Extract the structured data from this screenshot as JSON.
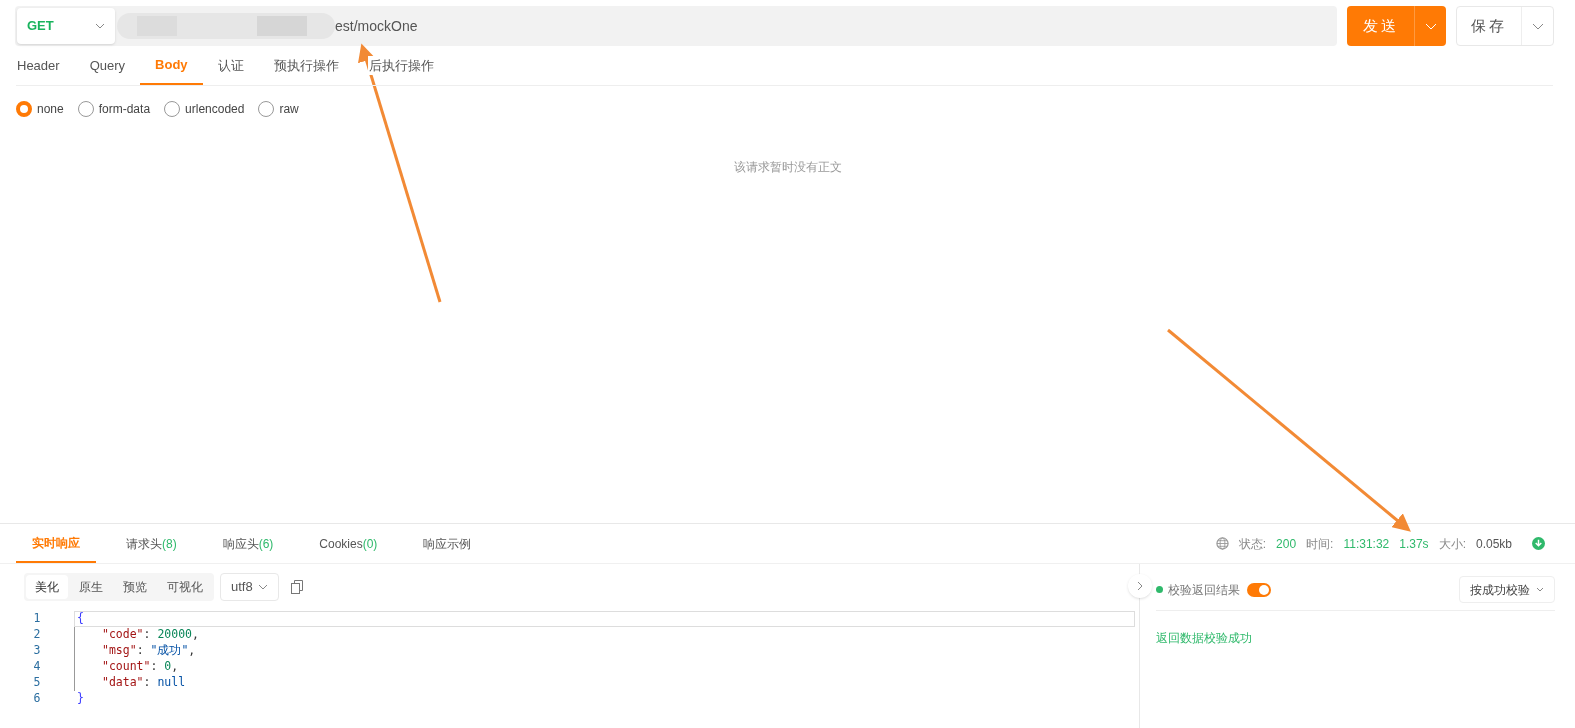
{
  "request": {
    "method": "GET",
    "url_visible": "est/mockOne",
    "send_label": "发送",
    "save_label": "保存"
  },
  "request_tabs": [
    {
      "label": "Header",
      "selected": false
    },
    {
      "label": "Query",
      "selected": false
    },
    {
      "label": "Body",
      "selected": true
    },
    {
      "label": "认证",
      "selected": false
    },
    {
      "label": "预执行操作",
      "selected": false
    },
    {
      "label": "后执行操作",
      "selected": false
    }
  ],
  "body_types": [
    {
      "label": "none",
      "selected": true
    },
    {
      "label": "form-data",
      "selected": false
    },
    {
      "label": "urlencoded",
      "selected": false
    },
    {
      "label": "raw",
      "selected": false
    }
  ],
  "body_empty_text": "该请求暂时没有正文",
  "response_tabs": [
    {
      "label": "实时响应",
      "selected": true
    },
    {
      "label": "请求头",
      "count": "(8)",
      "selected": false
    },
    {
      "label": "响应头",
      "count": "(6)",
      "selected": false
    },
    {
      "label": "Cookies",
      "count": "(0)",
      "selected": false
    },
    {
      "label": "响应示例",
      "selected": false
    }
  ],
  "status": [
    {
      "label": "状态:",
      "value": "200",
      "color": "#2fb96b"
    },
    {
      "label": "时间:",
      "value": "11:31:32",
      "color": "#2fb96b"
    },
    {
      "value": "1.37s",
      "color": "#2fb96b"
    },
    {
      "label": "大小:",
      "value": "0.05kb",
      "color": "#555555"
    }
  ],
  "view_modes": [
    {
      "label": "美化",
      "selected": true
    },
    {
      "label": "原生",
      "selected": false
    },
    {
      "label": "预览",
      "selected": false
    },
    {
      "label": "可视化",
      "selected": false
    }
  ],
  "encoding": "utf8",
  "code_lines": [
    {
      "number": "1",
      "active": true,
      "indented": false,
      "tokens": [
        {
          "kind": "brace",
          "text": "{"
        }
      ]
    },
    {
      "number": "2",
      "active": false,
      "indented": true,
      "tokens": [
        {
          "kind": "key",
          "text": "\"code\""
        },
        {
          "kind": "punct",
          "text": ": "
        },
        {
          "kind": "number",
          "text": "20000"
        },
        {
          "kind": "punct",
          "text": ","
        }
      ]
    },
    {
      "number": "3",
      "active": false,
      "indented": true,
      "tokens": [
        {
          "kind": "key",
          "text": "\"msg\""
        },
        {
          "kind": "punct",
          "text": ": "
        },
        {
          "kind": "string",
          "text": "\"成功\""
        },
        {
          "kind": "punct",
          "text": ","
        }
      ]
    },
    {
      "number": "4",
      "active": false,
      "indented": true,
      "tokens": [
        {
          "kind": "key",
          "text": "\"count\""
        },
        {
          "kind": "punct",
          "text": ": "
        },
        {
          "kind": "number",
          "text": "0"
        },
        {
          "kind": "punct",
          "text": ","
        }
      ]
    },
    {
      "number": "5",
      "active": false,
      "indented": true,
      "tokens": [
        {
          "kind": "key",
          "text": "\"data\""
        },
        {
          "kind": "punct",
          "text": ": "
        },
        {
          "kind": "null",
          "text": "null"
        }
      ]
    },
    {
      "number": "6",
      "active": false,
      "indented": false,
      "tokens": [
        {
          "kind": "brace",
          "text": "}"
        }
      ]
    }
  ],
  "validation": {
    "label": "校验返回结果",
    "on": true,
    "mode": "按成功校验",
    "result": "返回数据校验成功"
  }
}
